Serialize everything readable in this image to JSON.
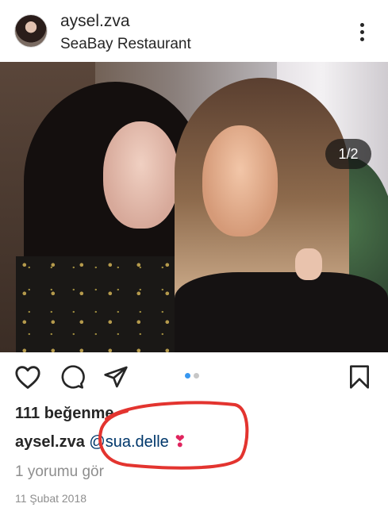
{
  "header": {
    "username": "aysel.zva",
    "location": "SeaBay Restaurant",
    "avatar_icon": "profile-avatar",
    "more_icon": "more-vertical-icon"
  },
  "photo": {
    "counter": "1/2"
  },
  "actions": {
    "icons": [
      "heart-icon",
      "comment-icon",
      "share-icon",
      "bookmark-icon"
    ],
    "carousel_active": 1,
    "carousel_total": 2,
    "active_dot_color": "#3897f0",
    "inactive_dot_color": "#c7c7c7"
  },
  "post": {
    "likes": "111 beğenme",
    "caption_user": "aysel.zva",
    "caption_mention": "@sua.delle",
    "caption_emoji": "❣",
    "view_comments": "1 yorumu gör",
    "date": "11 Şubat 2018"
  },
  "colors": {
    "text": "#262626",
    "secondary_text": "#8e8e8e",
    "mention": "#00376b",
    "annotation": "#e3342f"
  }
}
